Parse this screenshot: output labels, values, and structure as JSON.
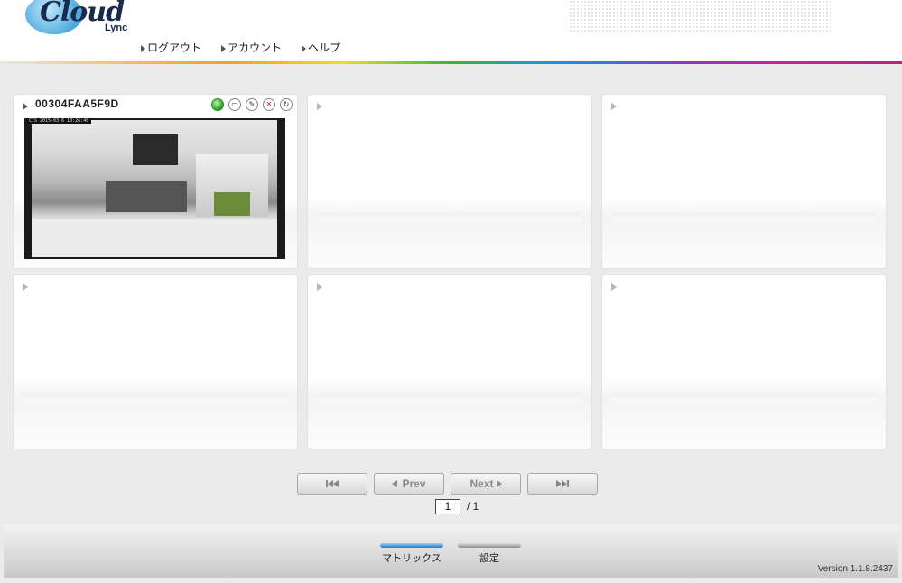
{
  "header": {
    "logo_text": "Cloud",
    "logo_sub": "Lync",
    "nav": [
      {
        "label": "ログアウト"
      },
      {
        "label": "アカウント"
      },
      {
        "label": "ヘルプ"
      }
    ]
  },
  "cameras": [
    {
      "name": "00304FAA5F9D",
      "has_video": true,
      "video_timestamp": "CIS 2015-03-6 10:26:40",
      "status": "online"
    },
    {
      "name": "",
      "has_video": false
    },
    {
      "name": "",
      "has_video": false
    },
    {
      "name": "",
      "has_video": false
    },
    {
      "name": "",
      "has_video": false
    },
    {
      "name": "",
      "has_video": false
    }
  ],
  "camera_controls": [
    "status-icon",
    "snapshot-icon",
    "settings-icon",
    "mute-icon",
    "refresh-icon"
  ],
  "pagination": {
    "prev_label": "Prev",
    "next_label": "Next",
    "current_page": "1",
    "total_pages": "/ 1"
  },
  "footer": {
    "tabs": [
      {
        "label": "マトリックス",
        "active": true
      },
      {
        "label": "設定",
        "active": false
      }
    ],
    "version": "Version 1.1.8.2437"
  },
  "colors": {
    "accent_blue": "#2a78c2",
    "status_green": "#2aa02a",
    "mute_red": "#dd1111",
    "background": "#ebebeb"
  }
}
